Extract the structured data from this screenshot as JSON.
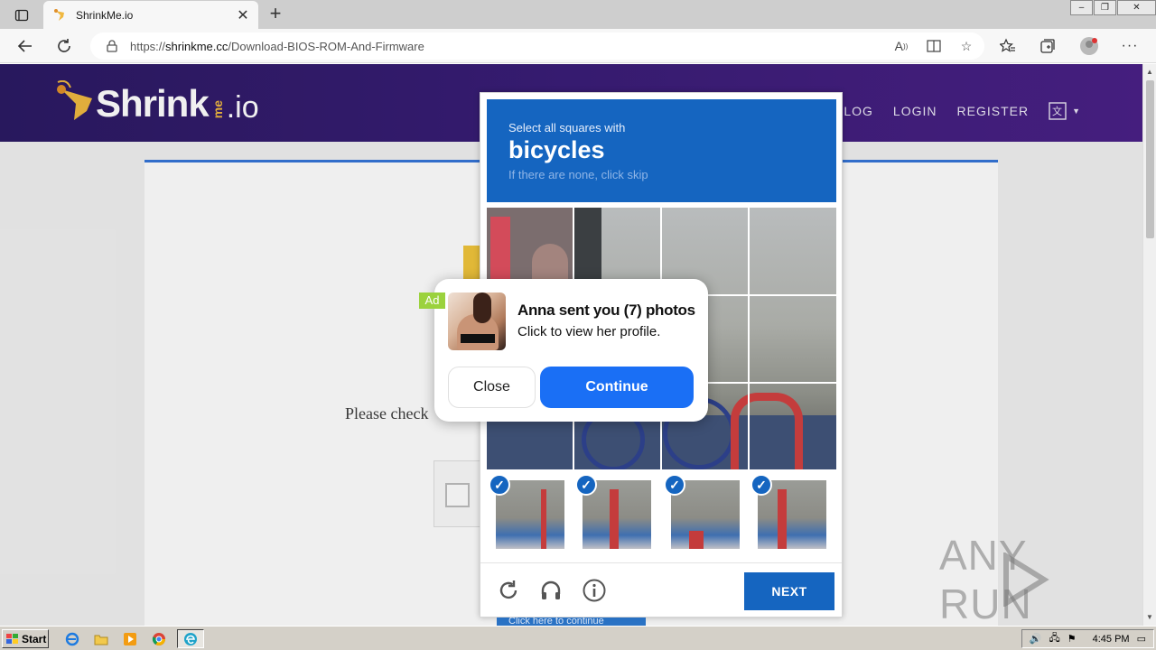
{
  "browser": {
    "tab_title": "ShrinkMe.io",
    "url_prefix": "https://",
    "url_host": "shrinkme.cc",
    "url_path": "/Download-BIOS-ROM-And-Firmware",
    "window_controls": [
      "–",
      "❐",
      "✕"
    ]
  },
  "site": {
    "logo_text": "Shrink",
    "logo_me": "me",
    "logo_io": ".io",
    "nav": [
      "BLOG",
      "LOGIN",
      "REGISTER"
    ],
    "please_text": "Please check"
  },
  "captcha": {
    "instruction": "Select all squares with",
    "target": "bicycles",
    "hint": "If there are none, click skip",
    "next_label": "NEXT",
    "link_text": "Click here to continue"
  },
  "ad": {
    "badge": "Ad",
    "title": "Anna sent you (7) photos",
    "subtitle": "Click to view her profile.",
    "close_label": "Close",
    "continue_label": "Continue"
  },
  "watermark": "ANY RUN",
  "taskbar": {
    "start_label": "Start",
    "clock": "4:45 PM"
  },
  "colors": {
    "captcha_blue": "#1565c0",
    "continue_blue": "#1a6ff5",
    "header_purple": "#3a1d77",
    "ad_badge": "#9bd23d"
  }
}
